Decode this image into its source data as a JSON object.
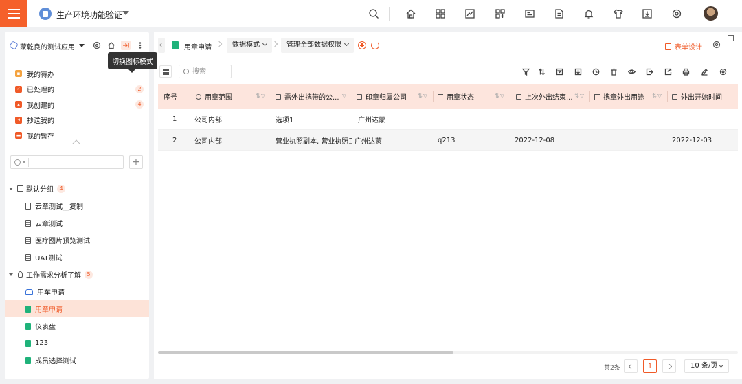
{
  "topbar": {
    "app_title": "生产环境功能验证",
    "icons": [
      "search-icon",
      "home-icon",
      "apps-icon",
      "chart-icon",
      "grid-add-icon",
      "id-card-icon",
      "document-icon",
      "bell-icon",
      "shirt-icon",
      "download-icon",
      "settings-circle-icon"
    ]
  },
  "sidebar": {
    "app_name": "蒙乾良的测试应用",
    "tooltip": "切换图标模式",
    "quick": [
      {
        "label": "我的待办",
        "color": "#f4a340",
        "badge": ""
      },
      {
        "label": "已处理的",
        "color": "#f05a28",
        "badge": "2"
      },
      {
        "label": "我创建的",
        "color": "#f05a28",
        "badge": "4"
      },
      {
        "label": "抄送我的",
        "color": "#f05a28",
        "badge": ""
      },
      {
        "label": "我的暂存",
        "color": "#f05a28",
        "badge": ""
      }
    ],
    "search_placeholder": "",
    "groups": [
      {
        "label": "默认分组",
        "count": "4",
        "items": [
          "云章测试__复制",
          "云章测试",
          "医疗图片预览测试",
          "UAT测试"
        ]
      },
      {
        "label": "工作需求分析了解",
        "count": "5",
        "items": [
          "用车申请",
          "用章申请",
          "仪表盘",
          "123",
          "成员选择测试"
        ]
      }
    ]
  },
  "crumb": {
    "title": "用章申请",
    "mode": "数据模式",
    "scope": "管理全部数据权限",
    "form_design": "表单设计"
  },
  "toolbar": {
    "search_placeholder": "搜索"
  },
  "table": {
    "columns": [
      "序号",
      "用章范围",
      "需外出携带的公...",
      "印章归属公司",
      "用章状态",
      "上次外出结束...",
      "携章外出用途",
      "外出开始时间"
    ],
    "rows": [
      [
        "1",
        "公司内部",
        "选项1",
        "广州达蒙",
        "",
        "",
        "",
        ""
      ],
      [
        "2",
        "公司内部",
        "营业执照副本, 营业执照正",
        "广州达蒙",
        "q213",
        "2022-12-08",
        "",
        "2022-12-03"
      ]
    ]
  },
  "pager": {
    "total": "共2条",
    "current": "1",
    "page_size": "10 条/页"
  },
  "colors": {
    "accent": "#f05a28",
    "header_bg": "#fde5dd",
    "active_bg": "#fde3d8",
    "menu_bg": "#f5602a"
  }
}
